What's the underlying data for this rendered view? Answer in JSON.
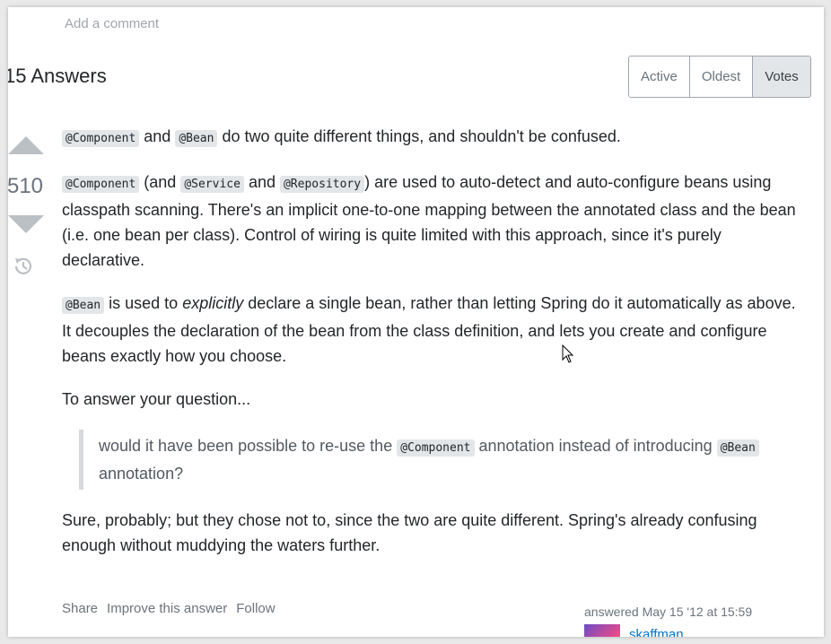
{
  "comment": {
    "add_label": "Add a comment"
  },
  "answers": {
    "heading": "15 Answers"
  },
  "sort": {
    "options": [
      "Active",
      "Oldest",
      "Votes"
    ],
    "selected": "Votes"
  },
  "vote": {
    "count": "510",
    "up_icon": "vote-up-arrow-icon",
    "down_icon": "vote-down-arrow-icon",
    "history_icon": "history-icon"
  },
  "post": {
    "p1": {
      "code1": "@Component",
      "t1": " and ",
      "code2": "@Bean",
      "t2": " do two quite different things, and shouldn't be confused."
    },
    "p2": {
      "code1": "@Component",
      "t1": " (and ",
      "code2": "@Service",
      "t2": " and ",
      "code3": "@Repository",
      "t3": ") are used to auto-detect and auto-configure beans using classpath scanning. There's an implicit one-to-one mapping between the annotated class and the bean (i.e. one bean per class). Control of wiring is quite limited with this approach, since it's purely declarative."
    },
    "p3": {
      "code1": "@Bean",
      "t1": " is used to ",
      "em": "explicitly",
      "t2": " declare a single bean, rather than letting Spring do it automatically as above. It decouples the declaration of the bean from the class definition, and lets you create and configure beans exactly how you choose."
    },
    "p4": "To answer your question...",
    "quote": {
      "t1": "would it have been possible to re-use the ",
      "code1": "@Component",
      "t2": " annotation instead of introducing ",
      "code2": "@Bean",
      "t3": " annotation?"
    },
    "p5": "Sure, probably; but they chose not to, since the two are quite different. Spring's already confusing enough without muddying the waters further."
  },
  "menu": {
    "share": "Share",
    "improve": "Improve this answer",
    "follow": "Follow"
  },
  "author": {
    "answered": "answered May 15 '12 at 15:59",
    "name": "skaffman"
  },
  "colors": {
    "link": "#0074cc",
    "muted": "#6a737c",
    "code_bg": "#e3e6e8"
  }
}
